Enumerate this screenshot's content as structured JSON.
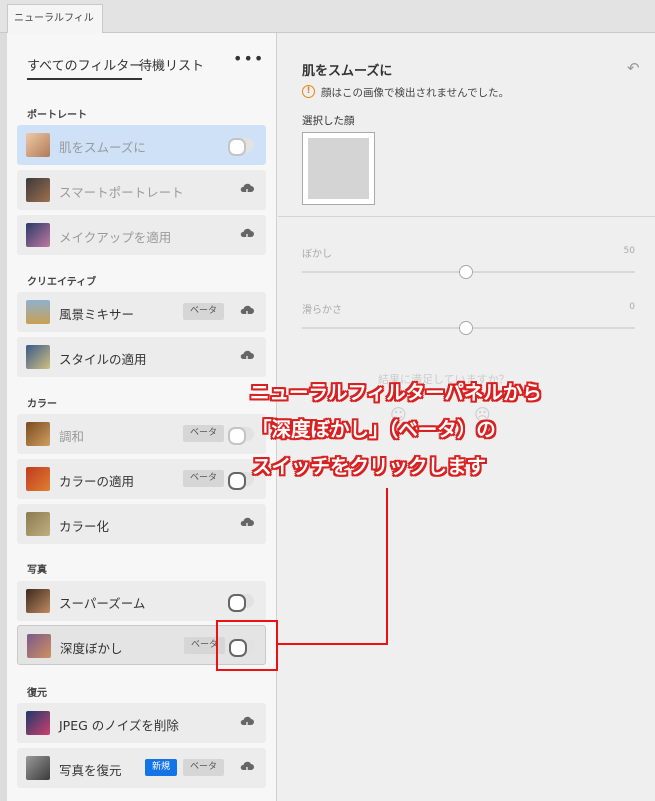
{
  "window": {
    "tab_title": "ニューラルフィルター"
  },
  "left_panel": {
    "tabs": [
      {
        "label": "すべてのフィルター",
        "active": true
      },
      {
        "label": "待機リスト",
        "active": false
      }
    ],
    "more_label": "•••",
    "sections": [
      {
        "title": "ポートレート",
        "items": [
          {
            "label": "肌をスムーズに",
            "state": "toggle-off",
            "selected": true,
            "dim": true
          },
          {
            "label": "スマートポートレート",
            "state": "cloud",
            "dim": true
          },
          {
            "label": "メイクアップを適用",
            "state": "cloud",
            "dim": true
          }
        ]
      },
      {
        "title": "クリエイティブ",
        "items": [
          {
            "label": "風景ミキサー",
            "badge": "ベータ",
            "state": "cloud"
          },
          {
            "label": "スタイルの適用",
            "state": "cloud"
          }
        ]
      },
      {
        "title": "カラー",
        "items": [
          {
            "label": "調和",
            "badge": "ベータ",
            "state": "toggle-off",
            "dim": true
          },
          {
            "label": "カラーの適用",
            "badge": "ベータ",
            "state": "toggle-off"
          },
          {
            "label": "カラー化",
            "state": "cloud"
          }
        ]
      },
      {
        "title": "写真",
        "items": [
          {
            "label": "スーパーズーム",
            "state": "toggle-off"
          },
          {
            "label": "深度ぼかし",
            "badge": "ベータ",
            "state": "toggle-off"
          }
        ]
      },
      {
        "title": "復元",
        "items": [
          {
            "label": "JPEG のノイズを削除",
            "state": "cloud"
          },
          {
            "label": "写真を復元",
            "badge_new": "新規",
            "badge": "ベータ",
            "state": "cloud"
          }
        ]
      }
    ]
  },
  "right_panel": {
    "title": "肌をスムーズに",
    "warning": "顔はこの画像で検出されませんでした。",
    "selected_face_label": "選択した顔",
    "sliders": [
      {
        "label": "ぼかし",
        "value": "50"
      },
      {
        "label": "滑らかさ",
        "value": "0"
      }
    ],
    "feedback_prompt": "結果に満足していますか？"
  },
  "annotation": {
    "lines": [
      "ニューラルフィルターパネルから",
      "「深度ぼかし」（ベータ）の",
      "スイッチをクリックします"
    ],
    "color": "#d92020"
  }
}
